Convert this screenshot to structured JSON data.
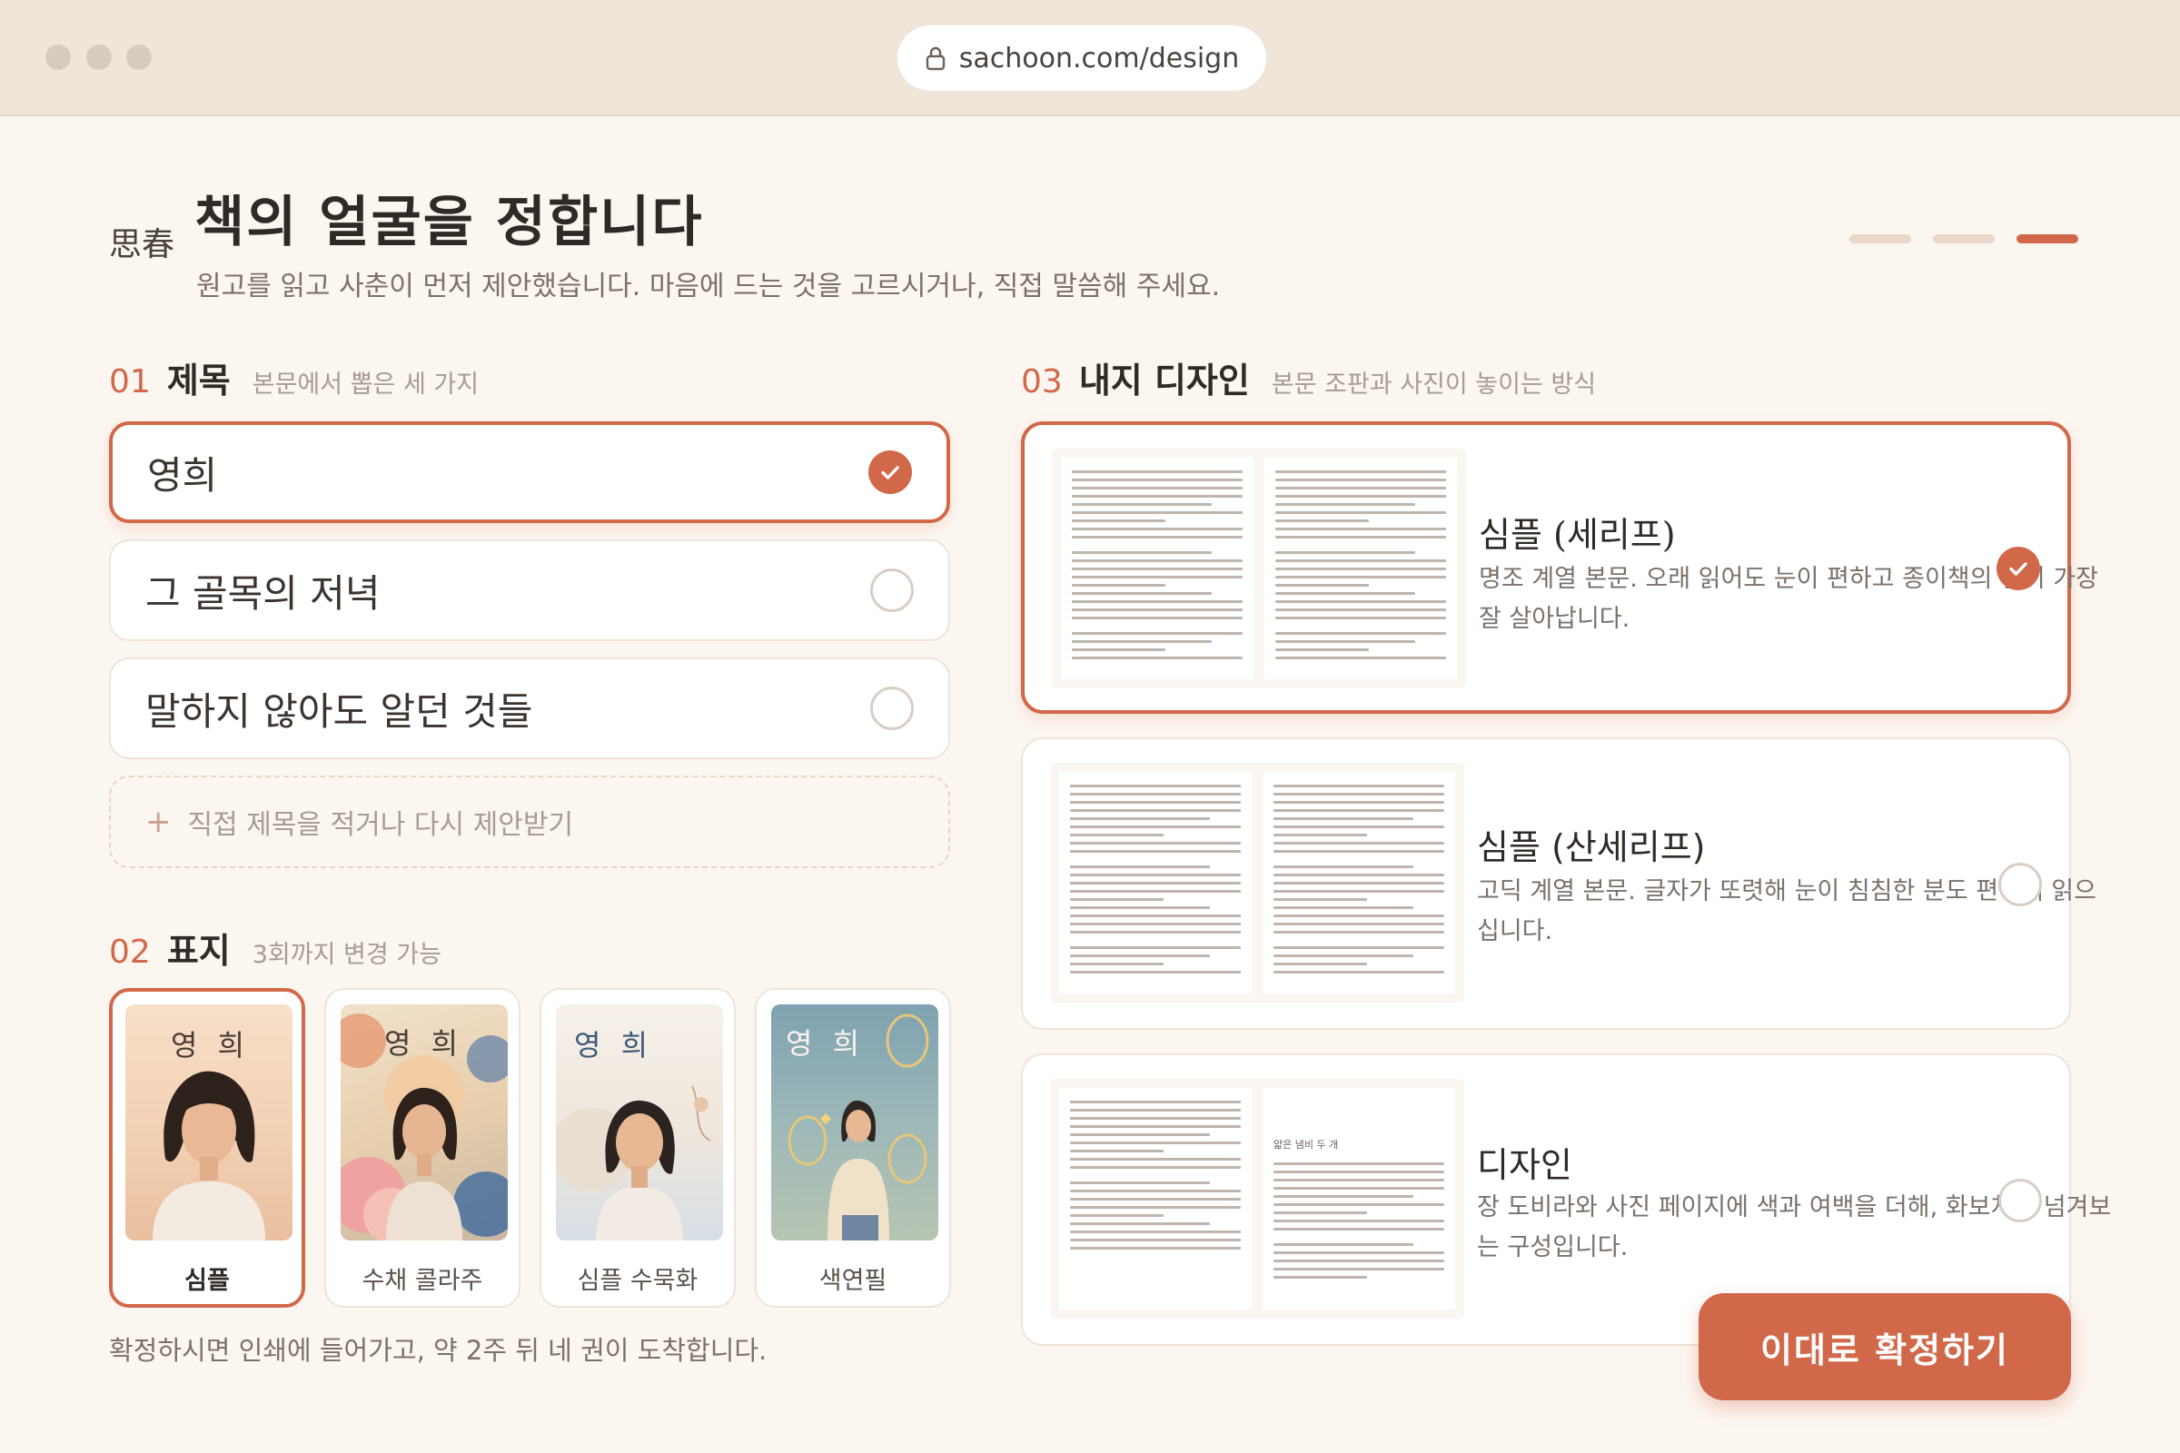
{
  "browser": {
    "url": "sachoon.com/design"
  },
  "header": {
    "brand": "思春",
    "title": "책의 얼굴을 정합니다",
    "subtitle": "원고를 읽고 사춘이 먼저 제안했습니다. 마음에 드는 것을 고르시거나, 직접 말씀해 주세요.",
    "progress": {
      "total": 3,
      "current": 3
    }
  },
  "titles": {
    "num": "01",
    "heading": "제목",
    "desc": "본문에서 뽑은 세 가지",
    "options": [
      {
        "label": "영희",
        "selected": true
      },
      {
        "label": "그 골목의 저녁",
        "selected": false
      },
      {
        "label": "말하지 않아도 알던 것들",
        "selected": false
      }
    ],
    "custom_label": "직접 제목을 적거나 다시 제안받기"
  },
  "covers": {
    "num": "02",
    "heading": "표지",
    "desc": "3회까지 변경 가능",
    "cover_text": "영 희",
    "options": [
      {
        "label": "심플",
        "selected": true
      },
      {
        "label": "수채 콜라주",
        "selected": false
      },
      {
        "label": "심플 수묵화",
        "selected": false
      },
      {
        "label": "색연필",
        "selected": false
      }
    ]
  },
  "layouts": {
    "num": "03",
    "heading": "내지 디자인",
    "desc": "본문 조판과 사진이 놓이는 방식",
    "options": [
      {
        "name": "심플 (세리프)",
        "desc": "명조 계열 본문. 오래 읽어도 눈이 편하고 종이책의 결이 가장 잘 살아납니다.",
        "selected": true
      },
      {
        "name": "심플 (산세리프)",
        "desc": "고딕 계열 본문. 글자가 또렷해 눈이 침침한 분도 편하게 읽으십니다.",
        "selected": false
      },
      {
        "name": "디자인",
        "desc": "장 도비라와 사진 페이지에 색과 여백을 더해, 화보처럼 넘겨보는 구성입니다.",
        "selected": false
      }
    ],
    "chapter_heading": "얇은 냄비 두 개"
  },
  "footer": {
    "notice": "확정하시면 인쇄에 들어가고, 약 2주 뒤 네 권이 도착합니다.",
    "confirm_label": "이대로 확정하기"
  },
  "colors": {
    "accent": "#d2684a",
    "background": "#fcf6f0",
    "chrome": "#efe5d9"
  },
  "icons": {
    "lock": "lock-icon",
    "check": "check-icon",
    "plus": "plus-icon"
  }
}
